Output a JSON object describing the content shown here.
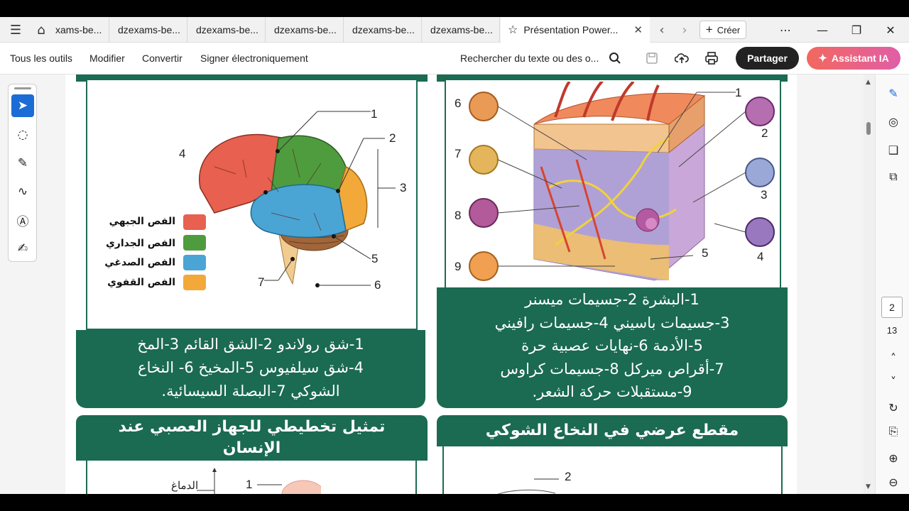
{
  "tabs": [
    {
      "label": "xams-be..."
    },
    {
      "label": "dzexams-be..."
    },
    {
      "label": "dzexams-be..."
    },
    {
      "label": "dzexams-be..."
    },
    {
      "label": "dzexams-be..."
    },
    {
      "label": "dzexams-be..."
    },
    {
      "label": "Présentation Power..."
    }
  ],
  "tabbar": {
    "create_label": "Créer"
  },
  "toolbar": {
    "all_tools": "Tous les outils",
    "edit": "Modifier",
    "convert": "Convertir",
    "sign": "Signer électroniquement",
    "search_placeholder": "Rechercher du texte ou des o...",
    "share": "Partager",
    "assistant": "Assistant IA"
  },
  "pager": {
    "current": "2",
    "total": "13"
  },
  "brain": {
    "numbers": [
      "1",
      "2",
      "3",
      "4",
      "5",
      "6",
      "7"
    ],
    "legend": [
      {
        "label": "الفص الجبهي",
        "color": "#e8604f"
      },
      {
        "label": "الفص الجداري",
        "color": "#4f9c3f"
      },
      {
        "label": "الفص الصدغي",
        "color": "#4aa5d4"
      },
      {
        "label": "الفص القفوي",
        "color": "#f2a93a"
      }
    ],
    "caption": [
      "1-شق رولاندو 2-الشق القائم 3-المخ",
      "4-شق سيلفيوس 5-المخيخ 6- النخاع",
      "الشوكي 7-البصلة السيسائية."
    ]
  },
  "skin": {
    "numbers": [
      "1",
      "2",
      "3",
      "4",
      "5",
      "6",
      "7",
      "8",
      "9"
    ],
    "caption": [
      "1-البشرة 2-جسيمات ميسنر",
      "3-جسيمات باسيني 4-جسيمات رافيني",
      "5-الأدمة 6-نهايات عصبية حرة",
      "7-أقراص ميركل 8-جسيمات كراوس",
      "9-مستقبلات حركة الشعر."
    ]
  },
  "lower_left": {
    "title_line1": "تمثيل تخطيطي للجهاز العصبي عند",
    "title_line2": "الإنسان",
    "label_brain": "الدماغ",
    "num1": "1"
  },
  "lower_right": {
    "title": "مقطع عرضي في النخاع الشوكي",
    "num2": "2"
  }
}
